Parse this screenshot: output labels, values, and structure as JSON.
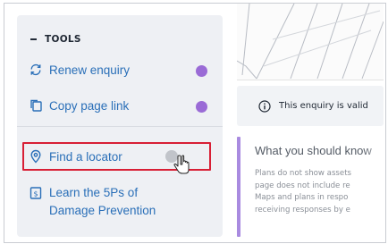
{
  "tools": {
    "header": "TOOLS",
    "items": [
      {
        "label": "Renew enquiry",
        "icon": "renew-icon"
      },
      {
        "label": "Copy page link",
        "icon": "copy-link-icon"
      },
      {
        "label": "Find a locator",
        "icon": "location-pin-icon"
      }
    ],
    "learn": {
      "line1": "Learn the 5Ps of",
      "line2": "Damage Prevention",
      "icon": "document-dollar-icon"
    }
  },
  "notice": {
    "text": "This enquiry is valid"
  },
  "section": {
    "title": "What you should know",
    "lines": [
      "Plans do not show assets",
      "page does not include re",
      "Maps and plans in respo",
      "receiving responses by e"
    ]
  },
  "colors": {
    "accent_blue": "#2a6fb8",
    "badge_purple": "#9a6bd6",
    "highlight_red": "#d81f35",
    "section_bar": "#a98be0"
  }
}
